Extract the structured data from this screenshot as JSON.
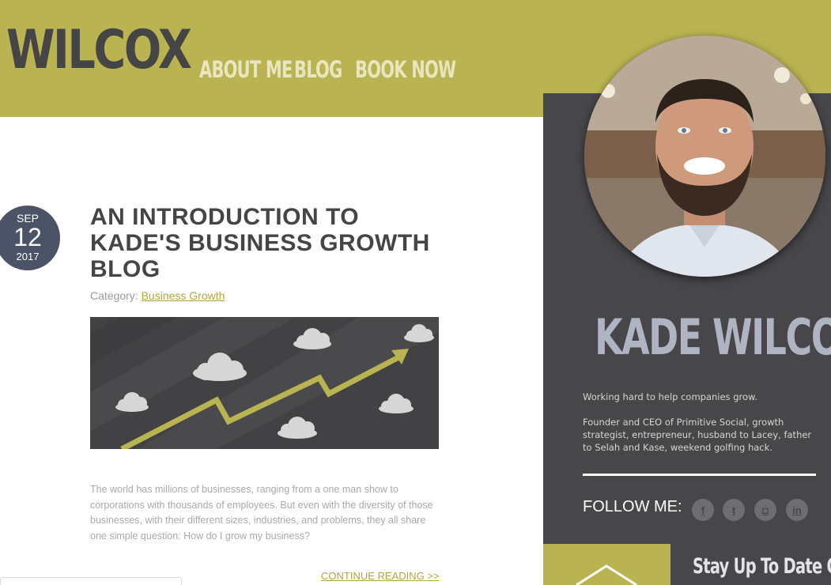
{
  "header": {
    "logo": "WILCOX",
    "nav": [
      {
        "label": "ABOUT ME"
      },
      {
        "label": "BLOG"
      },
      {
        "label": "BOOK NOW"
      }
    ]
  },
  "post": {
    "date": {
      "month": "SEP",
      "day": "12",
      "year": "2017"
    },
    "title": "AN INTRODUCTION TO KADE'S BUSINESS GROWTH BLOG",
    "category_label": "Category:",
    "category": "Business Growth",
    "excerpt": "The world has millions of businesses, ranging from a one man show to corporations with thousands of employees. But even with the diversity of those businesses, with their different sizes, industries, and problems, they all share one simple question: How do I grow my business?",
    "continue_label": "CONTINUE READING >>"
  },
  "sidebar": {
    "name": "KADE WILCOX",
    "tagline": "Working hard to help companies grow.",
    "bio": "Founder and CEO of Primitive Social, growth strategist, entrepreneur, husband to Lacey, father to Selah and Kase, weekend golfing hack.",
    "follow_label": "FOLLOW ME:",
    "social": [
      {
        "icon": "facebook-icon",
        "glyph": "f"
      },
      {
        "icon": "twitter-icon",
        "glyph": "t"
      },
      {
        "icon": "instagram-icon",
        "glyph": "◘"
      },
      {
        "icon": "linkedin-icon",
        "glyph": "in"
      }
    ],
    "newsletter_title": "Stay Up To Date On"
  },
  "colors": {
    "accent": "#bab351",
    "dark": "#474649",
    "date_badge": "#4a5466",
    "name": "#aeb4c2"
  }
}
